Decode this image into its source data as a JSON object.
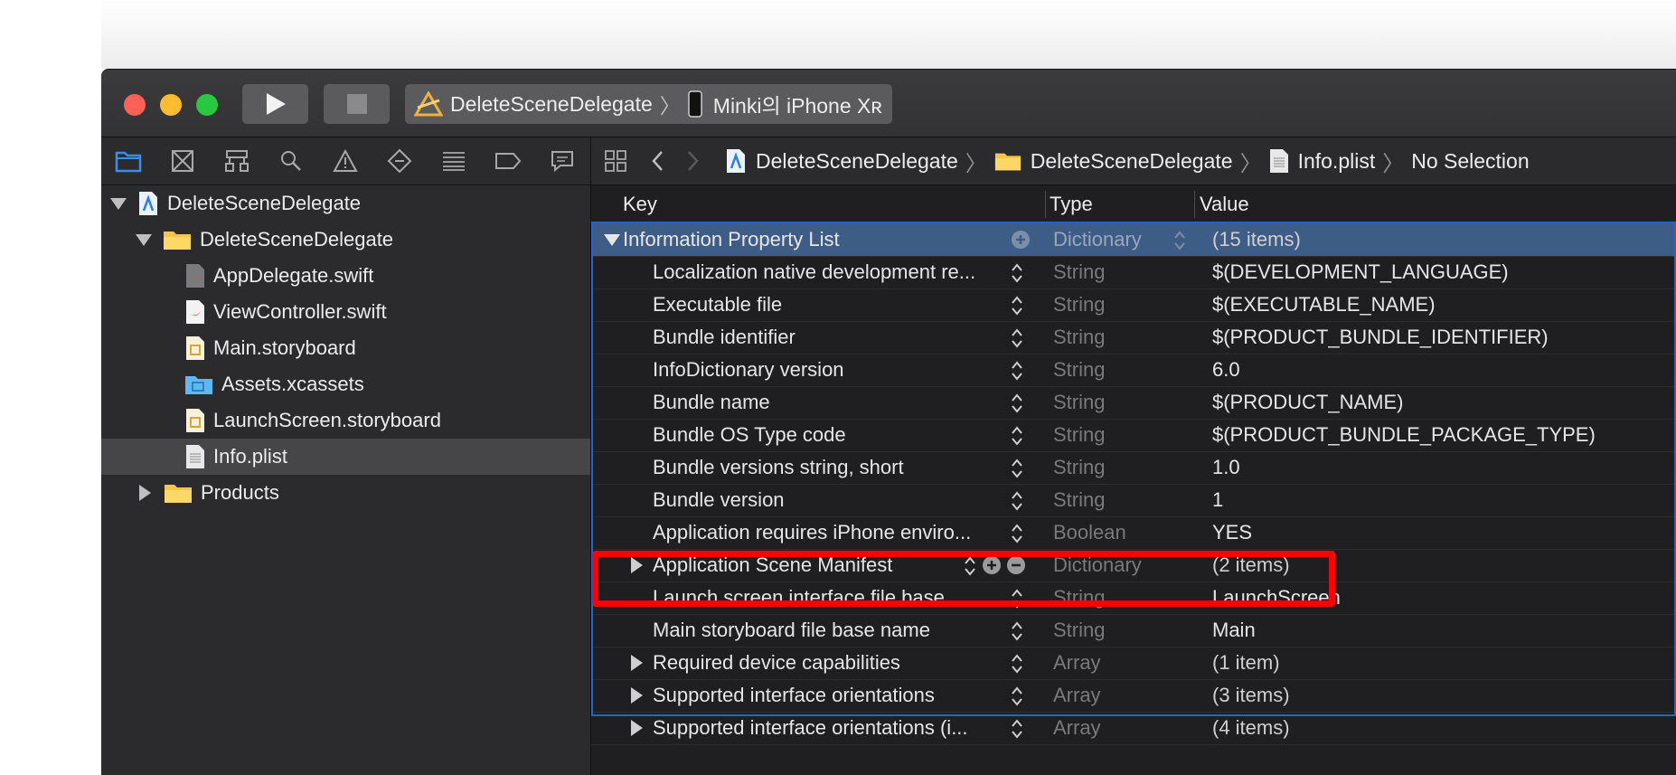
{
  "toolbar": {
    "scheme": "DeleteSceneDelegate",
    "device": "Minki의 iPhone Xʀ"
  },
  "navigator": {
    "tabs": [
      "project-navigator",
      "source-control",
      "symbol",
      "find",
      "issue",
      "test",
      "debug",
      "breakpoint",
      "report"
    ],
    "tree": [
      {
        "label": "DeleteSceneDelegate",
        "kind": "project",
        "level": 0,
        "expanded": true
      },
      {
        "label": "DeleteSceneDelegate",
        "kind": "folder",
        "level": 1,
        "expanded": true
      },
      {
        "label": "AppDelegate.swift",
        "kind": "swift",
        "level": 2
      },
      {
        "label": "ViewController.swift",
        "kind": "swift",
        "level": 2
      },
      {
        "label": "Main.storyboard",
        "kind": "storyboard",
        "level": 2
      },
      {
        "label": "Assets.xcassets",
        "kind": "assets",
        "level": 2
      },
      {
        "label": "LaunchScreen.storyboard",
        "kind": "storyboard",
        "level": 2
      },
      {
        "label": "Info.plist",
        "kind": "plist",
        "level": 2,
        "selected": true
      },
      {
        "label": "Products",
        "kind": "folder",
        "level": 1,
        "expanded": false
      }
    ]
  },
  "jumpbar": {
    "crumb1": "DeleteSceneDelegate",
    "crumb2": "DeleteSceneDelegate",
    "crumb3": "Info.plist",
    "crumb4": "No Selection"
  },
  "plist": {
    "headers": {
      "key": "Key",
      "type": "Type",
      "value": "Value"
    },
    "rows": [
      {
        "key": "Information Property List",
        "type": "Dictionary",
        "value": "(15 items)",
        "disclosure": "down",
        "root": true
      },
      {
        "key": "Localization native development re...",
        "type": "String",
        "value": "$(DEVELOPMENT_LANGUAGE)"
      },
      {
        "key": "Executable file",
        "type": "String",
        "value": "$(EXECUTABLE_NAME)"
      },
      {
        "key": "Bundle identifier",
        "type": "String",
        "value": "$(PRODUCT_BUNDLE_IDENTIFIER)"
      },
      {
        "key": "InfoDictionary version",
        "type": "String",
        "value": "6.0"
      },
      {
        "key": "Bundle name",
        "type": "String",
        "value": "$(PRODUCT_NAME)"
      },
      {
        "key": "Bundle OS Type code",
        "type": "String",
        "value": "$(PRODUCT_BUNDLE_PACKAGE_TYPE)"
      },
      {
        "key": "Bundle versions string, short",
        "type": "String",
        "value": "1.0"
      },
      {
        "key": "Bundle version",
        "type": "String",
        "value": "1"
      },
      {
        "key": "Application requires iPhone enviro...",
        "type": "Boolean",
        "value": "YES"
      },
      {
        "key": "Application Scene Manifest",
        "type": "Dictionary",
        "value": "(2 items)",
        "disclosure": "right",
        "highlighted": true
      },
      {
        "key": "Launch screen interface file base...",
        "type": "String",
        "value": "LaunchScreen"
      },
      {
        "key": "Main storyboard file base name",
        "type": "String",
        "value": "Main"
      },
      {
        "key": "Required device capabilities",
        "type": "Array",
        "value": "(1 item)",
        "disclosure": "right"
      },
      {
        "key": "Supported interface orientations",
        "type": "Array",
        "value": "(3 items)",
        "disclosure": "right"
      },
      {
        "key": "Supported interface orientations (i...",
        "type": "Array",
        "value": "(4 items)",
        "disclosure": "right"
      }
    ]
  },
  "colors": {
    "selection": "#3e5d86",
    "annotation": "#ff0000",
    "focus_frame": "#2a63c6"
  }
}
